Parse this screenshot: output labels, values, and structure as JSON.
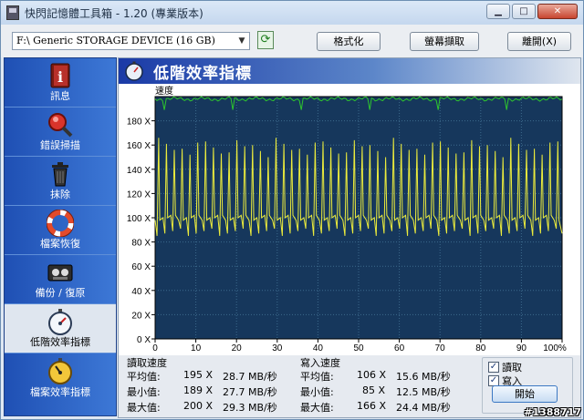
{
  "window": {
    "title": "快閃記憶體工具箱 - 1.20 (專業版本)",
    "minimize_glyph": "▁",
    "maximize_glyph": "□",
    "close_glyph": "✕"
  },
  "toolbar": {
    "device_value": "F:\\ Generic STORAGE DEVICE (16 GB)",
    "refresh_glyph": "⟳",
    "format_label": "格式化",
    "screenshot_label": "螢幕擷取",
    "exit_label": "離開(X)"
  },
  "sidebar": {
    "items": [
      {
        "label": "訊息",
        "icon": "info-book-icon"
      },
      {
        "label": "錯誤掃描",
        "icon": "magnifier-icon"
      },
      {
        "label": "抹除",
        "icon": "trash-icon"
      },
      {
        "label": "檔案恢復",
        "icon": "lifebuoy-icon"
      },
      {
        "label": "備份 / 復原",
        "icon": "tape-icon"
      },
      {
        "label": "低階效率指標",
        "icon": "stopwatch-icon",
        "active": true
      },
      {
        "label": "檔案效率指標",
        "icon": "stopwatch-gold-icon"
      }
    ]
  },
  "panel": {
    "title": "低階效率指標",
    "icon": "stopwatch-icon"
  },
  "chart_data": {
    "type": "line",
    "ylabel": "速度",
    "yticks": [
      "0 X",
      "20 X",
      "40 X",
      "60 X",
      "80 X",
      "100 X",
      "120 X",
      "140 X",
      "160 X",
      "180 X"
    ],
    "xticks": [
      "0",
      "10",
      "20",
      "30",
      "40",
      "50",
      "60",
      "70",
      "80",
      "90",
      "100%"
    ],
    "ylim": [
      0,
      200
    ],
    "xlim": [
      0,
      100
    ],
    "grid": true,
    "series": [
      {
        "color": "#2ec52e",
        "min": 189,
        "max": 200,
        "avg": 195
      },
      {
        "color": "#ecec3c",
        "min": 85,
        "max": 166,
        "avg": 106
      }
    ]
  },
  "stats": {
    "read": {
      "title": "讀取速度",
      "rows": [
        {
          "label": "平均值:",
          "x": "195 X",
          "speed": "28.7 MB/秒"
        },
        {
          "label": "最小值:",
          "x": "189 X",
          "speed": "27.7 MB/秒"
        },
        {
          "label": "最大值:",
          "x": "200 X",
          "speed": "29.3 MB/秒"
        }
      ]
    },
    "write": {
      "title": "寫入速度",
      "rows": [
        {
          "label": "平均值:",
          "x": "106 X",
          "speed": "15.6 MB/秒"
        },
        {
          "label": "最小值:",
          "x": "85 X",
          "speed": "12.5 MB/秒"
        },
        {
          "label": "最大值:",
          "x": "166 X",
          "speed": "24.4 MB/秒"
        }
      ]
    },
    "options": {
      "read_label": "讀取",
      "write_label": "寫入",
      "read_checked": true,
      "write_checked": true,
      "check_glyph": "✓",
      "start_label": "開始"
    }
  },
  "watermark": "#1388717"
}
